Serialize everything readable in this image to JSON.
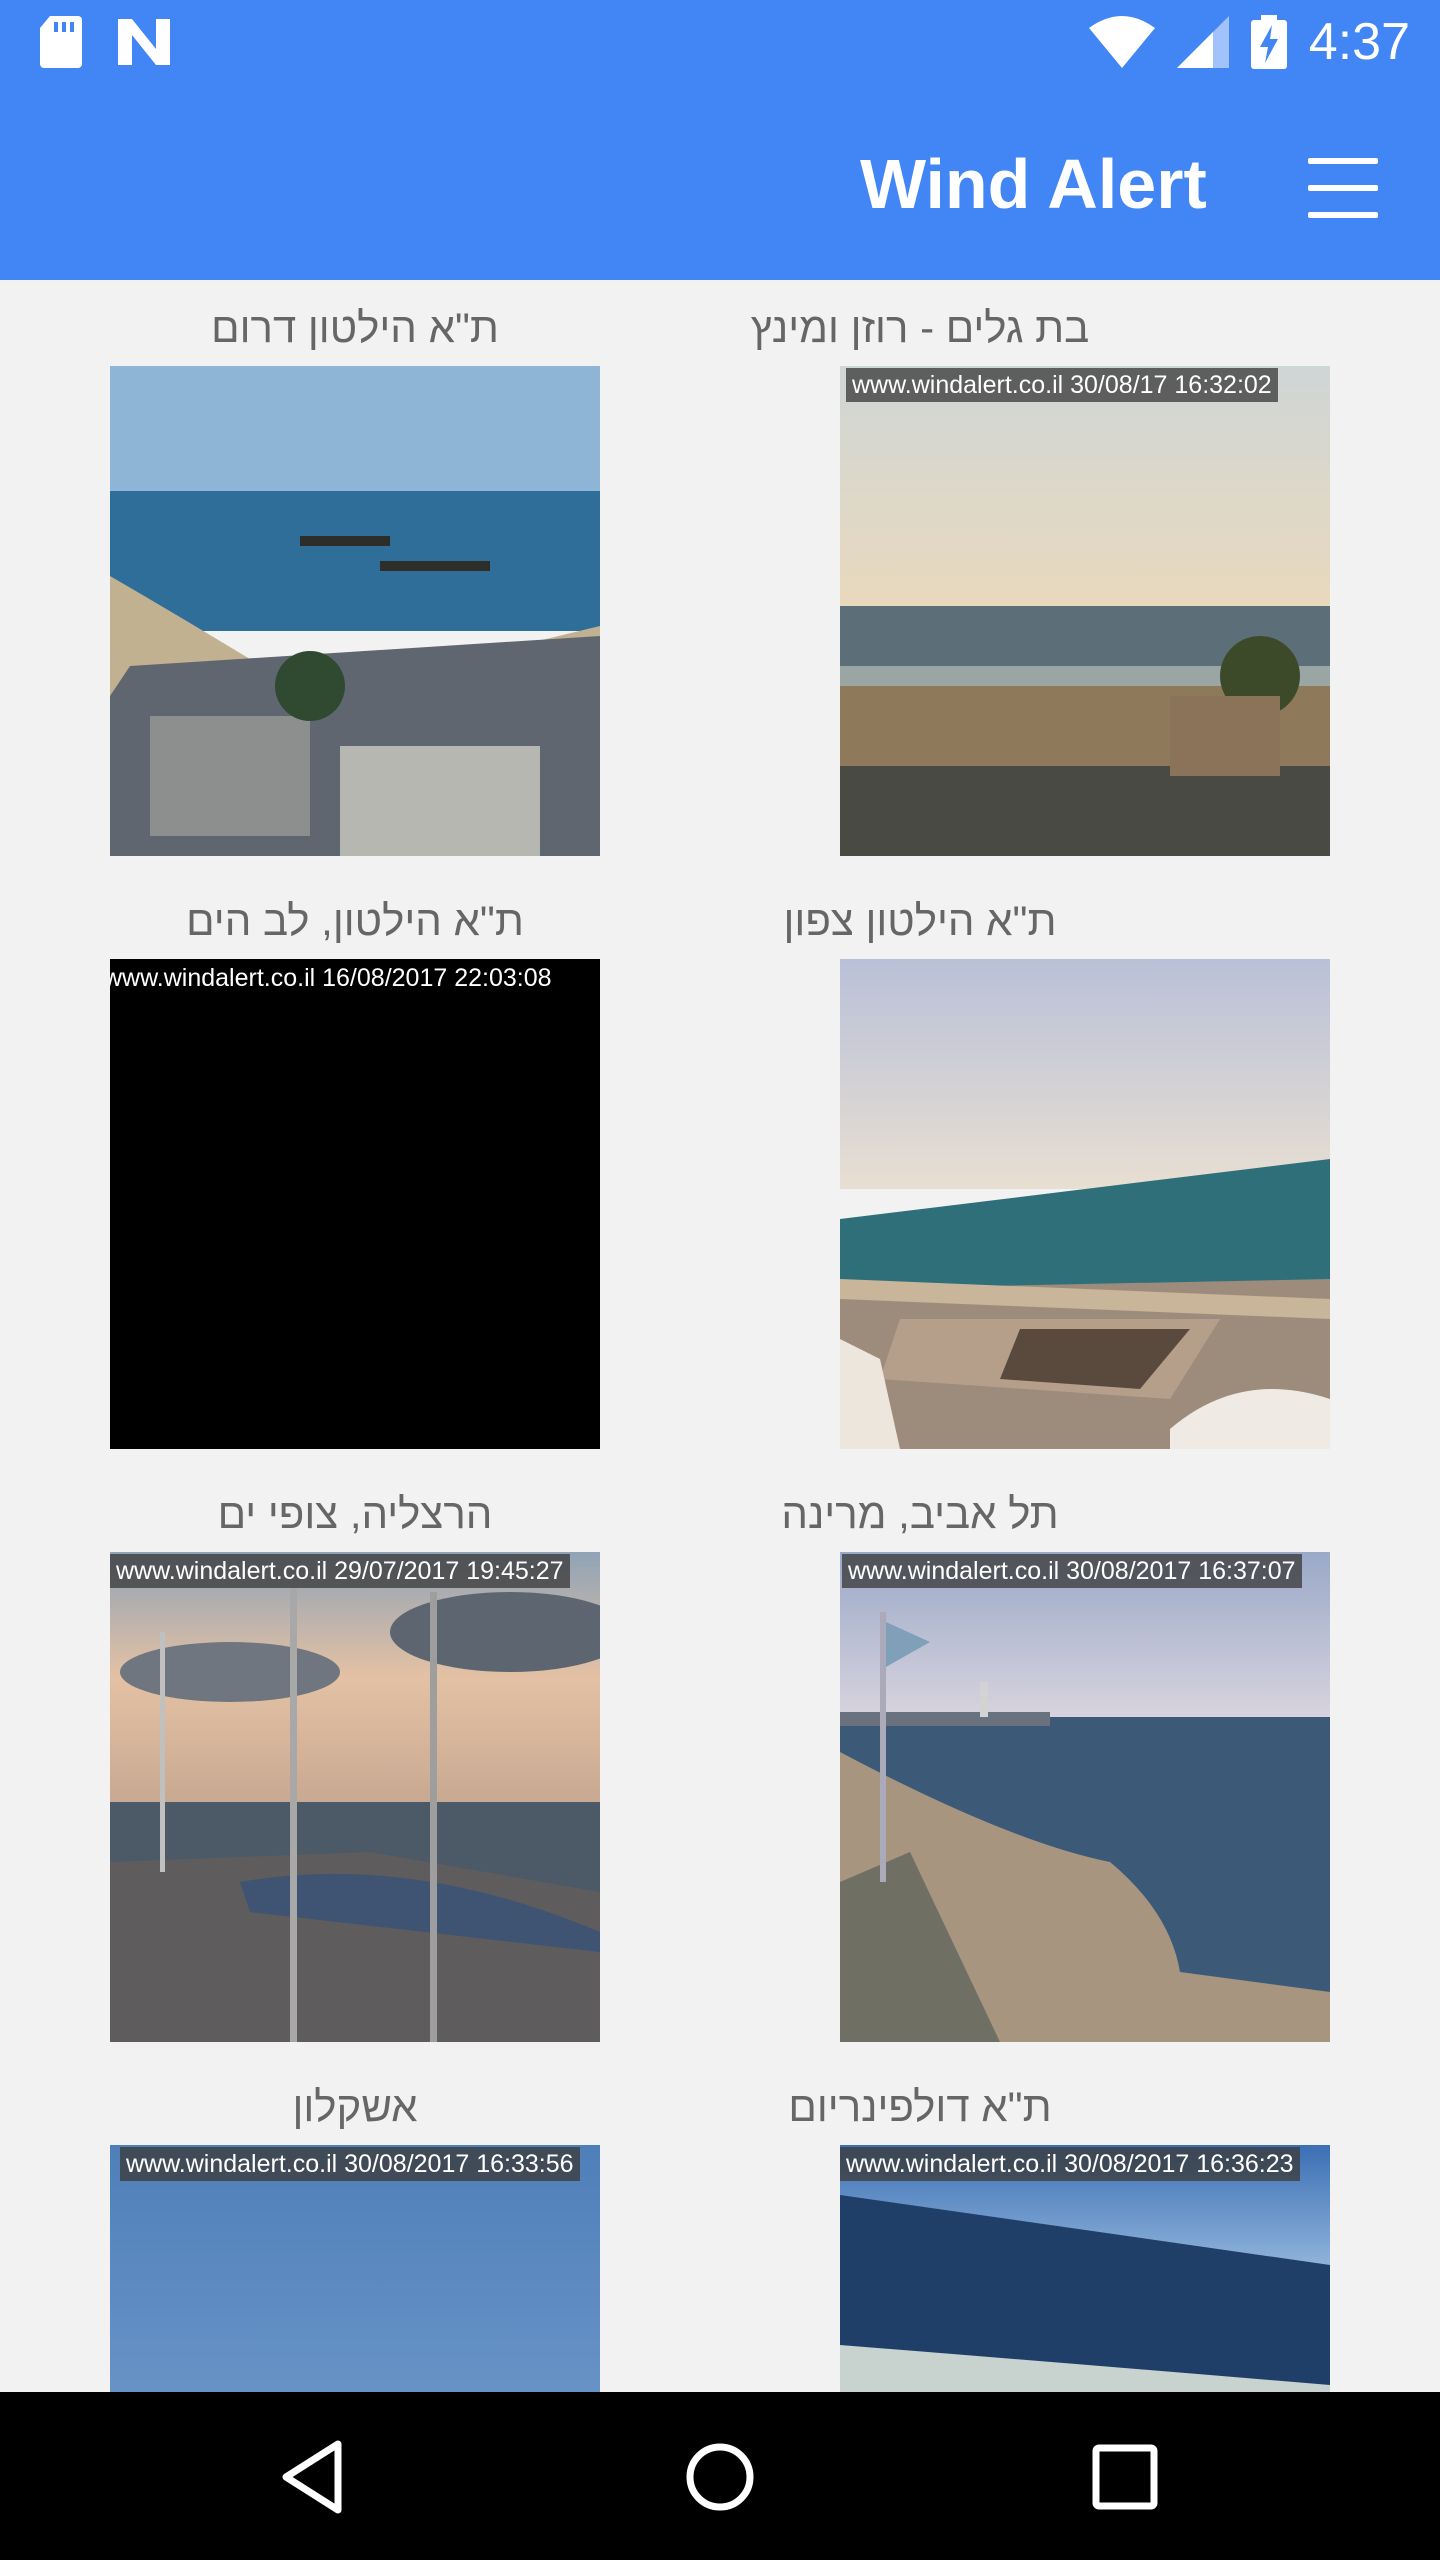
{
  "status_bar": {
    "time": "4:37",
    "left_icons": [
      "sd-card-icon",
      "n-logo-icon"
    ],
    "right_icons": [
      "wifi-icon",
      "cell-signal-icon",
      "battery-charging-icon"
    ]
  },
  "app_bar": {
    "title": "Wind Alert",
    "menu_icon": "hamburger-menu-icon",
    "background": "#4285f4"
  },
  "cameras": [
    {
      "title": "בת גלים - רוזן ומינץ",
      "stamp": "www.windalert.co.il 30/08/17 16:32:02"
    },
    {
      "title": "ת\"א הילטון דרום",
      "stamp": ""
    },
    {
      "title": "ת\"א הילטון צפון",
      "stamp": ""
    },
    {
      "title": "ת\"א הילטון, לב הים",
      "stamp": "www.windalert.co.il 16/08/2017 22:03:08"
    },
    {
      "title": "תל אביב, מרינה",
      "stamp": "www.windalert.co.il 30/08/2017 16:37:07"
    },
    {
      "title": "הרצליה, צופי ים",
      "stamp": "www.windalert.co.il 29/07/2017 19:45:27"
    },
    {
      "title": "ת\"א דולפינריום",
      "stamp": "www.windalert.co.il 30/08/2017 16:36:23"
    },
    {
      "title": "אשקלון",
      "stamp": "www.windalert.co.il  30/08/2017 16:33:56"
    }
  ],
  "nav_bar": {
    "buttons": [
      "back-icon",
      "home-icon",
      "recents-icon"
    ]
  }
}
